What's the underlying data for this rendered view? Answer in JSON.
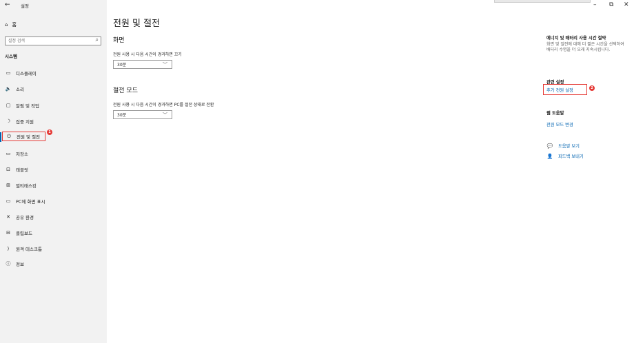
{
  "window": {
    "back": "←",
    "title": "설정",
    "min": "–",
    "restore": "⧉",
    "close": "✕"
  },
  "sidebar": {
    "home": {
      "icon": "⌂",
      "label": "홈"
    },
    "search": {
      "placeholder": "설정 검색",
      "icon": "⌕"
    },
    "section_title": "시스템",
    "items": [
      {
        "icon": "▭",
        "label": "디스플레이"
      },
      {
        "icon": "🔈",
        "label": "소리"
      },
      {
        "icon": "▢",
        "label": "알림 및 작업"
      },
      {
        "icon": "☽",
        "label": "집중 지원"
      },
      {
        "icon": "⏻",
        "label": "전원 및 절전"
      },
      {
        "icon": "▭",
        "label": "저장소"
      },
      {
        "icon": "⊡",
        "label": "태블릿"
      },
      {
        "icon": "⊞",
        "label": "멀티태스킹"
      },
      {
        "icon": "▭",
        "label": "PC에 화면 표시"
      },
      {
        "icon": "✕",
        "label": "공유 환경"
      },
      {
        "icon": "⊟",
        "label": "클립보드"
      },
      {
        "icon": "⟩",
        "label": "원격 데스크톱"
      },
      {
        "icon": "ⓘ",
        "label": "정보"
      }
    ],
    "badge1": "1"
  },
  "main": {
    "title": "전원 및 절전",
    "screen": {
      "heading": "화면",
      "label": "전원 사용 시 다음 시간이 경과하면 끄기",
      "value": "30분"
    },
    "sleep": {
      "heading": "절전 모드",
      "label": "전원 사용 시 다음 시간이 경과하면 PC를 절전 상태로 전환",
      "value": "30분"
    }
  },
  "right": {
    "energy_heading": "에너지 및 배터리 사용 시간 절약",
    "energy_text": "화면 및 절전에 대해 더 짧은 시간을 선택하여 배터리 수명을 더 오래 지속시킵니다.",
    "related_heading": "관련 설정",
    "related_link": "추가 전원 설정",
    "badge2": "2",
    "web_help_heading": "웹 도움말",
    "web_help_link": "전원 모드 변경",
    "help": {
      "icon": "💬",
      "label": "도움말 보기"
    },
    "feedback": {
      "icon": "👤",
      "label": "피드백 보내기"
    }
  }
}
